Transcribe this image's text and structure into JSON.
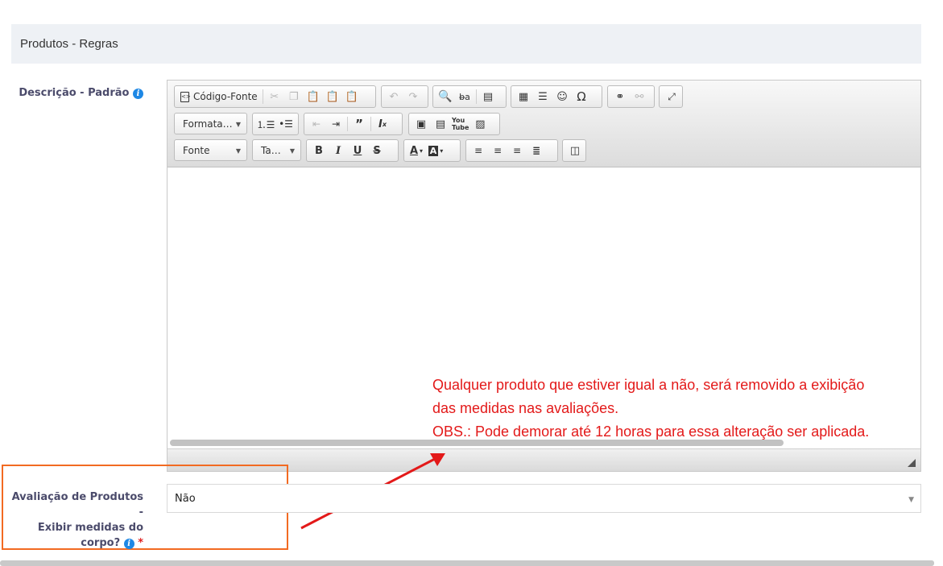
{
  "section": {
    "title": "Produtos - Regras"
  },
  "description_field": {
    "label": "Descrição - Padrão",
    "info": "i"
  },
  "editor": {
    "toolbar_row1": {
      "source_button": "Código-Fonte",
      "icons": [
        "cut-icon",
        "copy-icon",
        "paste-icon",
        "paste-text-icon",
        "paste-word-icon",
        "undo-icon",
        "redo-icon",
        "find-icon",
        "replace-icon",
        "select-all-icon",
        "table-icon",
        "horizontal-line-icon",
        "smiley-icon",
        "special-char-icon",
        "link-icon",
        "unlink-icon",
        "maximize-icon"
      ]
    },
    "toolbar_row2": {
      "format_combo": "Formata…",
      "icons": [
        "numbered-list-icon",
        "bulleted-list-icon",
        "outdent-icon",
        "indent-icon",
        "blockquote-icon",
        "remove-format-icon",
        "video-icon",
        "iframe-icon",
        "youtube-icon",
        "image-icon"
      ]
    },
    "toolbar_row3": {
      "font_combo": "Fonte",
      "size_combo": "Ta…",
      "icons": [
        "bold-icon",
        "italic-icon",
        "underline-icon",
        "strike-icon",
        "text-color-icon",
        "bg-color-icon",
        "align-left-icon",
        "align-center-icon",
        "align-right-icon",
        "justify-icon",
        "show-blocks-icon"
      ]
    },
    "content": ""
  },
  "annotation": {
    "line1": "Qualquer produto que estiver igual a não, será removido a exibição",
    "line2": "das medidas nas avaliações.",
    "line3": "OBS.: Pode demorar até 12 horas para essa alteração ser aplicada.",
    "color": "#e31919"
  },
  "rating_field": {
    "label_line1": "Avaliação de Produtos -",
    "label_line2": "Exibir medidas do",
    "label_line3": "corpo?",
    "info": "i",
    "required_mark": "*",
    "value": "Não"
  },
  "colors": {
    "header_bg": "#eef1f5",
    "highlight_box": "#f26a22",
    "info_icon": "#1e88e5"
  }
}
